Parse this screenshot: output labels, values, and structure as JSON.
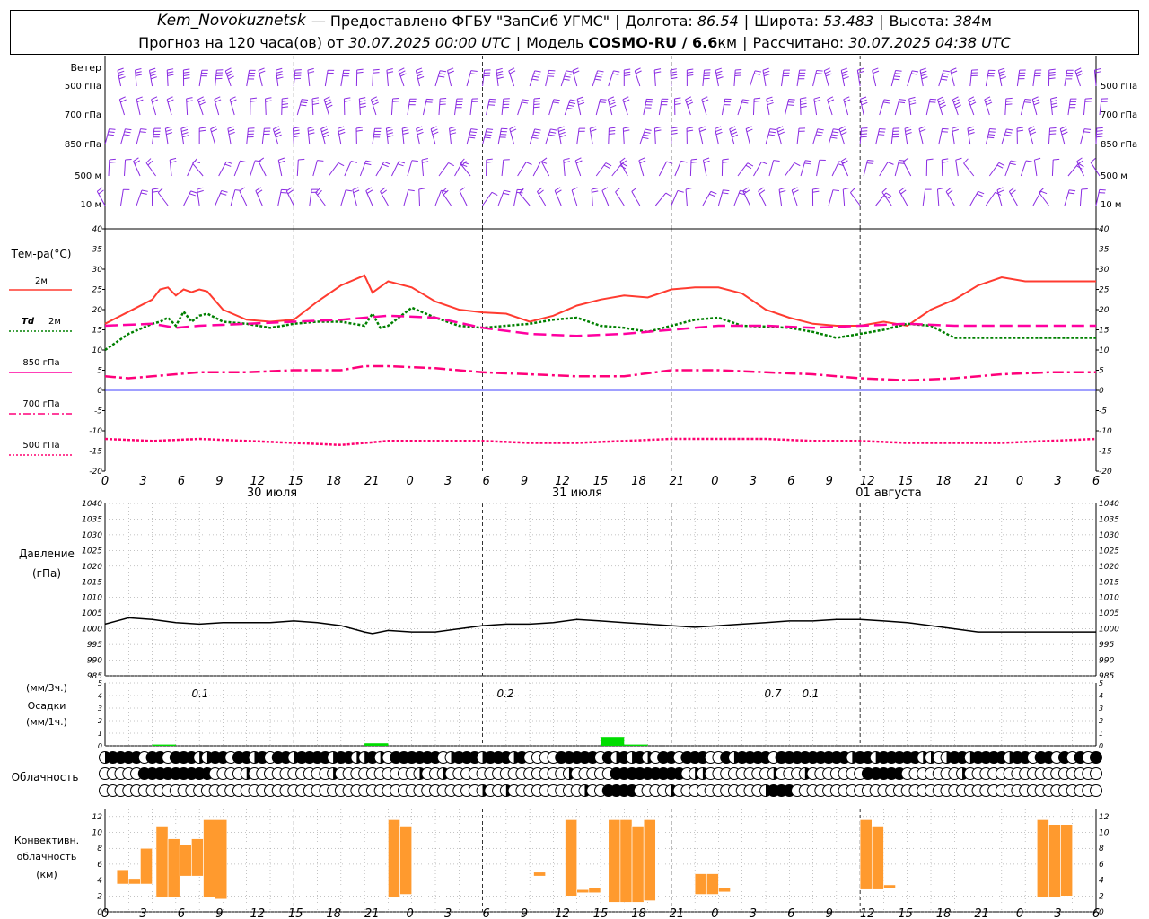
{
  "header": {
    "station": "Kem_Novokuznetsk",
    "provider": "— Предоставлено ФГБУ \"ЗапСиб УГМС\"",
    "lon_label": "Долгота:",
    "lon_value": "86.54",
    "lat_label": "Широта:",
    "lat_value": "53.483",
    "alt_label": "Высота:",
    "alt_value": "384",
    "alt_unit": "м",
    "forecast_prefix": "Прогноз на 120 часа(ов) от",
    "forecast_time": "30.07.2025 00:00 UTC",
    "model_label": "Модель",
    "model_name": "COSMO-RU / 6.6",
    "model_unit": "км",
    "calc_label": "Рассчитано:",
    "calc_time": "30.07.2025 04:38 UTC"
  },
  "colors": {
    "t2m": "#ff3b30",
    "td2m": "#008000",
    "t850": "#ff00a0",
    "t700": "#ff007a",
    "t500": "#ff0070",
    "wind": "#8a2be2",
    "pressure": "#000000",
    "zero_line": "#0000ff",
    "precip": "#00dd00",
    "convective": "#ff9a2e"
  },
  "x_hour_labels": [
    "0",
    "3",
    "6",
    "9",
    "12",
    "15",
    "18",
    "21",
    "0",
    "3",
    "6",
    "9",
    "12",
    "15",
    "18",
    "21",
    "0",
    "3",
    "6",
    "9",
    "12",
    "15",
    "18",
    "21",
    "0",
    "3",
    "6"
  ],
  "date_labels": [
    "30 июля",
    "31 июля",
    "01 августа"
  ],
  "chart_data": [
    {
      "type": "wind-barbs",
      "title": "Ветер",
      "levels": [
        "500 гПа",
        "700 гПа",
        "850 гПа",
        "500 м",
        "10 м"
      ],
      "x_hours": [
        0,
        126
      ]
    },
    {
      "type": "line",
      "title": "Тем-ра(°C)",
      "ylim": [
        -20,
        40
      ],
      "y_ticks": [
        40,
        35,
        30,
        25,
        20,
        15,
        10,
        5,
        0,
        -5,
        -10,
        -15,
        -20
      ],
      "series": [
        {
          "name": "2м",
          "style": "solid",
          "x": [
            0,
            3,
            6,
            7,
            8,
            9,
            10,
            11,
            12,
            13,
            15,
            18,
            21,
            24,
            27,
            30,
            33,
            34,
            36,
            39,
            42,
            45,
            48,
            51,
            54,
            57,
            60,
            63,
            66,
            69,
            72,
            75,
            78,
            81,
            84,
            87,
            90,
            93,
            96,
            99,
            102,
            105,
            108,
            111,
            114,
            117,
            120,
            123,
            126
          ],
          "values": [
            16.5,
            19.5,
            22.5,
            25,
            25.5,
            23.5,
            25,
            24.3,
            25,
            24.5,
            20,
            17.5,
            17,
            17.5,
            22,
            26,
            28.5,
            24.2,
            27,
            25.5,
            22,
            20,
            19.3,
            19,
            17,
            18.5,
            21,
            22.5,
            23.5,
            23,
            25,
            25.5,
            25.5,
            24,
            20,
            18,
            16.5,
            16,
            16,
            17,
            16,
            20,
            22.5,
            26,
            28,
            27,
            27,
            27,
            27
          ]
        },
        {
          "name": "Td 2м",
          "style": "dotted",
          "x": [
            0,
            3,
            6,
            7,
            8,
            9,
            10,
            11,
            12,
            13,
            15,
            18,
            21,
            24,
            27,
            30,
            33,
            34,
            35,
            36,
            39,
            42,
            45,
            48,
            51,
            54,
            57,
            60,
            63,
            66,
            69,
            72,
            75,
            78,
            81,
            84,
            87,
            90,
            93,
            96,
            99,
            102,
            105,
            108,
            111,
            114,
            117,
            120,
            123,
            126
          ],
          "values": [
            10,
            14,
            16.5,
            17,
            18,
            16,
            19.5,
            17,
            18.5,
            19,
            17,
            16.5,
            15.5,
            16.5,
            17,
            17,
            16,
            19,
            15.5,
            16,
            20.5,
            18,
            16,
            15.5,
            16,
            16.5,
            17.5,
            18,
            16,
            15.5,
            14.5,
            16,
            17.5,
            18,
            16,
            15.8,
            15.5,
            14.5,
            13,
            14,
            15,
            16.5,
            16,
            13,
            13,
            13,
            13,
            13,
            13,
            13
          ]
        },
        {
          "name": "850 гПа",
          "style": "longdash",
          "x": [
            0,
            6,
            9,
            12,
            18,
            24,
            30,
            36,
            42,
            48,
            54,
            60,
            66,
            72,
            78,
            84,
            90,
            96,
            102,
            108,
            114,
            120,
            126
          ],
          "values": [
            16,
            16.5,
            15.5,
            16,
            16.5,
            17,
            17.5,
            18.5,
            18,
            15.5,
            14,
            13.5,
            14,
            15,
            16,
            16,
            15.5,
            16,
            16.5,
            16,
            16,
            16,
            16
          ]
        },
        {
          "name": "700 гПа",
          "style": "dashdot",
          "x": [
            0,
            3,
            6,
            9,
            12,
            18,
            24,
            30,
            33,
            36,
            42,
            48,
            54,
            60,
            66,
            72,
            78,
            84,
            90,
            96,
            102,
            108,
            114,
            120,
            126
          ],
          "values": [
            3.5,
            3,
            3.5,
            4,
            4.5,
            4.5,
            5,
            5,
            6,
            6,
            5.5,
            4.5,
            4,
            3.5,
            3.5,
            5,
            5,
            4.5,
            4,
            3,
            2.5,
            3,
            4,
            4.5,
            4.5
          ]
        },
        {
          "name": "500 гПа",
          "style": "dotted",
          "x": [
            0,
            6,
            12,
            18,
            24,
            30,
            36,
            42,
            48,
            54,
            60,
            66,
            72,
            78,
            84,
            90,
            96,
            102,
            108,
            114,
            120,
            126
          ],
          "values": [
            -12,
            -12.5,
            -12,
            -12.5,
            -13,
            -13.5,
            -12.5,
            -12.5,
            -12.5,
            -13,
            -13,
            -12.5,
            -12,
            -12,
            -12,
            -12.5,
            -12.5,
            -13,
            -13,
            -13,
            -12.5,
            -12
          ]
        }
      ]
    },
    {
      "type": "line",
      "title": "Давление",
      "subtitle": "(гПа)",
      "ylim": [
        985,
        1040
      ],
      "y_ticks": [
        1040,
        1035,
        1030,
        1025,
        1020,
        1015,
        1010,
        1005,
        1000,
        995,
        990,
        985
      ],
      "series": [
        {
          "x": [
            0,
            3,
            6,
            9,
            12,
            15,
            18,
            21,
            24,
            27,
            30,
            33,
            34,
            36,
            39,
            42,
            45,
            48,
            51,
            54,
            57,
            60,
            63,
            66,
            69,
            72,
            75,
            78,
            81,
            84,
            87,
            90,
            93,
            96,
            99,
            102,
            105,
            108,
            111,
            114,
            117,
            120,
            123,
            126
          ],
          "values": [
            1001.5,
            1003.5,
            1003,
            1002,
            1001.5,
            1002,
            1002,
            1002,
            1002.5,
            1002,
            1001,
            999,
            998.5,
            999.5,
            999,
            999,
            1000,
            1001,
            1001.5,
            1001.5,
            1002,
            1003,
            1002.5,
            1002,
            1001.5,
            1001,
            1000.5,
            1001,
            1001.5,
            1002,
            1002.5,
            1002.5,
            1003,
            1003,
            1002.5,
            1002,
            1001,
            1000,
            999,
            999,
            999,
            999,
            999,
            999
          ]
        }
      ]
    },
    {
      "type": "bar",
      "title": "Осадки",
      "ylabel_top": "(мм/3ч.)",
      "ylabel_bottom": "(мм/1ч.)",
      "ylim": [
        0,
        5
      ],
      "y_ticks": [
        5,
        4,
        3,
        2,
        1,
        0
      ],
      "bars": [
        {
          "x": [
            6,
            9
          ],
          "value": 0.1
        },
        {
          "x": [
            33,
            36
          ],
          "value": 0.2
        },
        {
          "x": [
            63,
            66
          ],
          "value": 0.7
        },
        {
          "x": [
            66,
            69
          ],
          "value": 0.1
        }
      ],
      "annotations": [
        "0.1",
        "0.2",
        "0.7",
        "0.1"
      ]
    },
    {
      "type": "cloud-symbols",
      "title": "Облачность",
      "rows": 3,
      "x_hours": [
        0,
        126
      ]
    },
    {
      "type": "bar",
      "title": "Конвективн. облачность (км)",
      "ylim": [
        0,
        13
      ],
      "y_ticks": [
        12,
        10,
        8,
        6,
        4,
        2,
        0
      ],
      "bars": [
        {
          "x": [
            1.5,
            3
          ],
          "bottom": 3.5,
          "top": 5.3
        },
        {
          "x": [
            3,
            4.5
          ],
          "bottom": 3.5,
          "top": 4.2
        },
        {
          "x": [
            4.5,
            6
          ],
          "bottom": 3.5,
          "top": 8
        },
        {
          "x": [
            6.5,
            8
          ],
          "bottom": 1.8,
          "top": 10.8
        },
        {
          "x": [
            8,
            9.5
          ],
          "bottom": 1.8,
          "top": 9.2
        },
        {
          "x": [
            9.5,
            11
          ],
          "bottom": 4.5,
          "top": 8.5
        },
        {
          "x": [
            11,
            12.5
          ],
          "bottom": 4.5,
          "top": 9.2
        },
        {
          "x": [
            12.5,
            14
          ],
          "bottom": 1.8,
          "top": 11.6
        },
        {
          "x": [
            14,
            15.5
          ],
          "bottom": 1.6,
          "top": 11.6
        },
        {
          "x": [
            36,
            37.5
          ],
          "bottom": 1.8,
          "top": 11.6
        },
        {
          "x": [
            37.5,
            39
          ],
          "bottom": 2.2,
          "top": 10.8
        },
        {
          "x": [
            54.5,
            56
          ],
          "bottom": 4.5,
          "top": 5
        },
        {
          "x": [
            58.5,
            60
          ],
          "bottom": 2,
          "top": 11.6
        },
        {
          "x": [
            60,
            61.5
          ],
          "bottom": 2.4,
          "top": 2.8
        },
        {
          "x": [
            61.5,
            63
          ],
          "bottom": 2.4,
          "top": 3
        },
        {
          "x": [
            64,
            65.5
          ],
          "bottom": 1.2,
          "top": 11.6
        },
        {
          "x": [
            65.5,
            67
          ],
          "bottom": 1.2,
          "top": 11.6
        },
        {
          "x": [
            67,
            68.5
          ],
          "bottom": 1.2,
          "top": 10.8
        },
        {
          "x": [
            68.5,
            70
          ],
          "bottom": 1.4,
          "top": 11.6
        },
        {
          "x": [
            75,
            76.5
          ],
          "bottom": 2.2,
          "top": 4.8
        },
        {
          "x": [
            76.5,
            78
          ],
          "bottom": 2.2,
          "top": 4.8
        },
        {
          "x": [
            78,
            79.5
          ],
          "bottom": 2.5,
          "top": 3
        },
        {
          "x": [
            96,
            97.5
          ],
          "bottom": 2.8,
          "top": 11.6
        },
        {
          "x": [
            97.5,
            99
          ],
          "bottom": 2.8,
          "top": 10.8
        },
        {
          "x": [
            99,
            100.5
          ],
          "bottom": 3,
          "top": 3.4
        },
        {
          "x": [
            118.5,
            120
          ],
          "bottom": 1.8,
          "top": 11.6
        },
        {
          "x": [
            120,
            121.5
          ],
          "bottom": 1.8,
          "top": 11
        },
        {
          "x": [
            121.5,
            123
          ],
          "bottom": 2,
          "top": 11
        }
      ]
    }
  ],
  "legend": {
    "t2m_label": "2м",
    "td_prefix": "Td",
    "td_label": "2м",
    "t850_label": "850 гПа",
    "t700_label": "700 гПа",
    "t500_label": "500 гПа"
  }
}
